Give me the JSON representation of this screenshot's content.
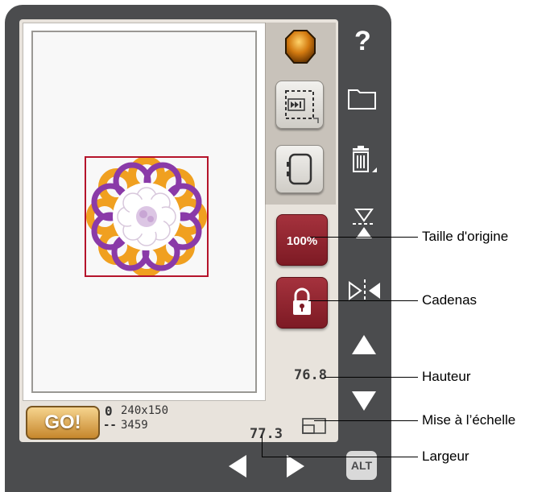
{
  "hoop_info": {
    "size": "240x150",
    "stitch_count": "3459",
    "hoop_glyph": "0",
    "dash_glyph": "--"
  },
  "go_button": {
    "label": "GO!"
  },
  "scale_button": {
    "label": "100%"
  },
  "dimensions": {
    "height": "76.8",
    "width": "77.3"
  },
  "side_bar": {
    "help_label": "?",
    "alt_label": "ALT"
  },
  "callouts": {
    "original_size": "Taille d'origine",
    "lock": "Cadenas",
    "height": "Hauteur",
    "scale": "Mise à l’échelle",
    "width": "Largeur"
  },
  "colors": {
    "hoop_border": "#b5142b",
    "purple": "#8a3aa8",
    "orange": "#f0a020",
    "button_red": "#8d2430",
    "go_gold": "#e0a850"
  }
}
